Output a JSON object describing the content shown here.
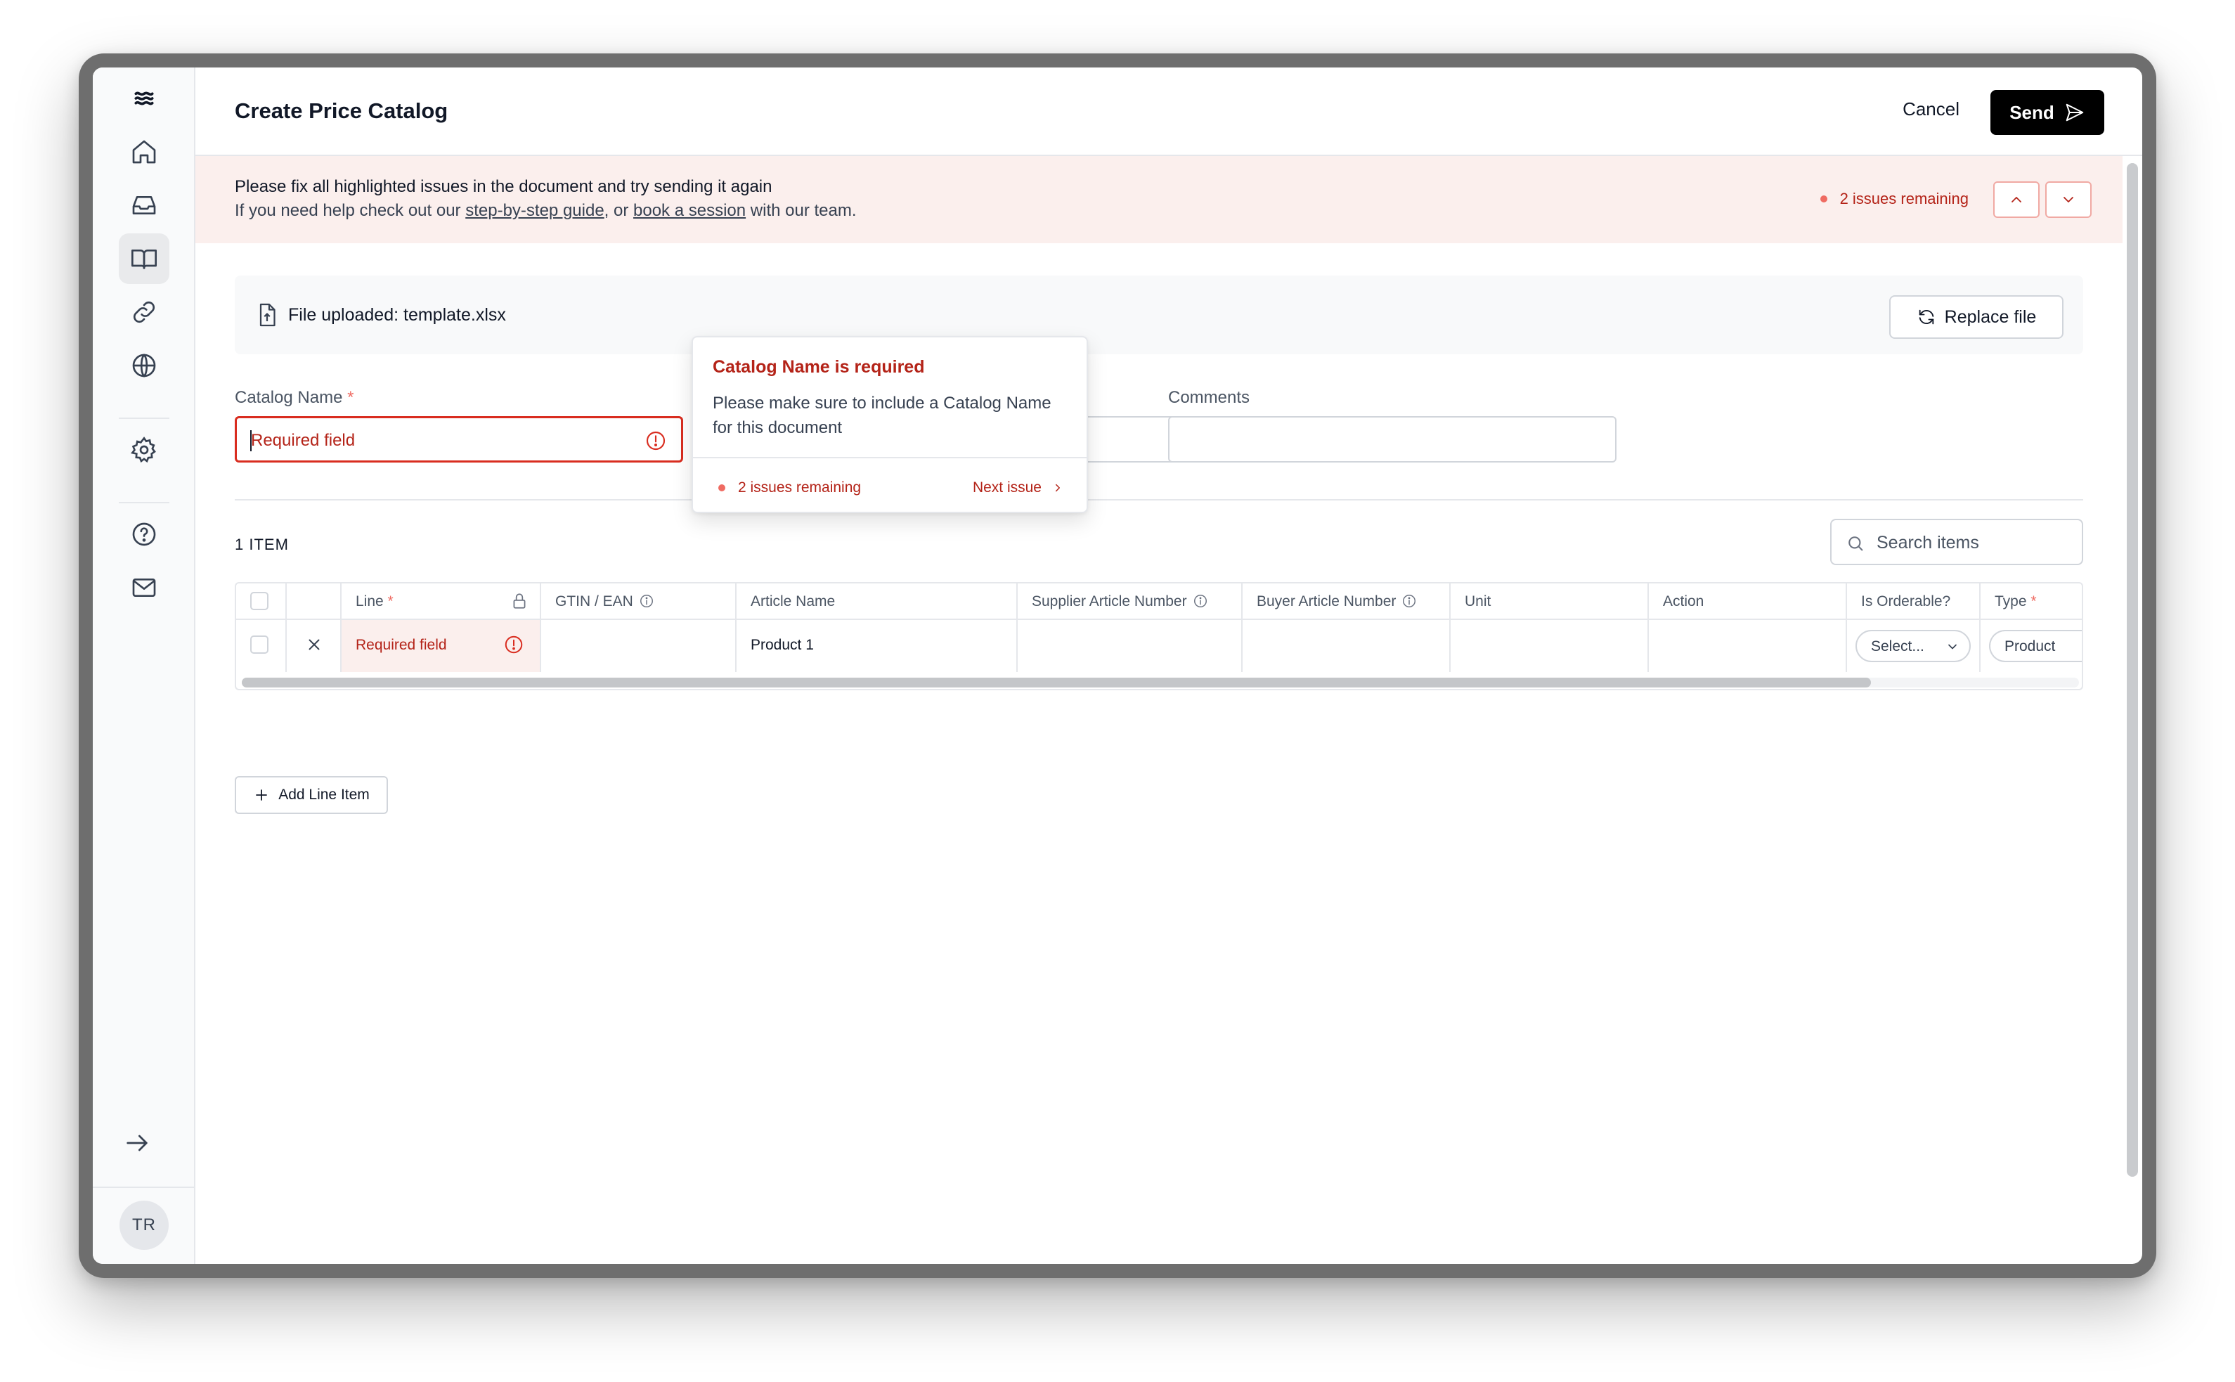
{
  "header": {
    "title": "Create Price Catalog",
    "cancel_label": "Cancel",
    "send_label": "Send"
  },
  "banner": {
    "title": "Please fix all highlighted issues in the document and try sending it again",
    "sub_prefix": "If you need help check out our ",
    "guide_link": "step-by-step guide",
    "sub_middle": ", or ",
    "session_link": "book a session",
    "sub_suffix": " with our team.",
    "issues": "2 issues remaining"
  },
  "file": {
    "label": "File uploaded: template.xlsx",
    "replace_label": "Replace file"
  },
  "form": {
    "catalog_name_label": "Catalog Name",
    "required_star": "*",
    "catalog_name_placeholder": "Required field",
    "comments_label": "Comments",
    "comments_value": ""
  },
  "popover": {
    "title": "Catalog Name is required",
    "body": "Please make sure to include a Catalog Name for this document",
    "issues": "2 issues remaining",
    "next": "Next issue"
  },
  "items": {
    "count_label": "1 ITEM",
    "search_placeholder": "Search items",
    "add_line_label": "Add Line Item",
    "columns": {
      "line": "Line",
      "gtin": "GTIN / EAN",
      "article_name": "Article Name",
      "supplier_article_number": "Supplier Article Number",
      "buyer_article_number": "Buyer Article Number",
      "unit": "Unit",
      "action": "Action",
      "is_orderable": "Is Orderable?",
      "type": "Type"
    },
    "rows": [
      {
        "line": "Required field",
        "gtin": "",
        "article_name": "Product 1",
        "supplier_article_number": "",
        "buyer_article_number": "",
        "unit": "",
        "action": "",
        "is_orderable": "Select...",
        "type": "Product"
      }
    ]
  },
  "user": {
    "initials": "TR"
  },
  "colors": {
    "error": "#d92d20",
    "error_text": "#b42318",
    "banner_bg": "#fbefed",
    "primary_button": "#000000"
  },
  "icons": {
    "sidebar": [
      "logo-icon",
      "home-icon",
      "inbox-icon",
      "book-icon",
      "link-icon",
      "globe-icon",
      "settings-icon",
      "help-icon",
      "mail-icon",
      "arrow-right-icon"
    ]
  }
}
